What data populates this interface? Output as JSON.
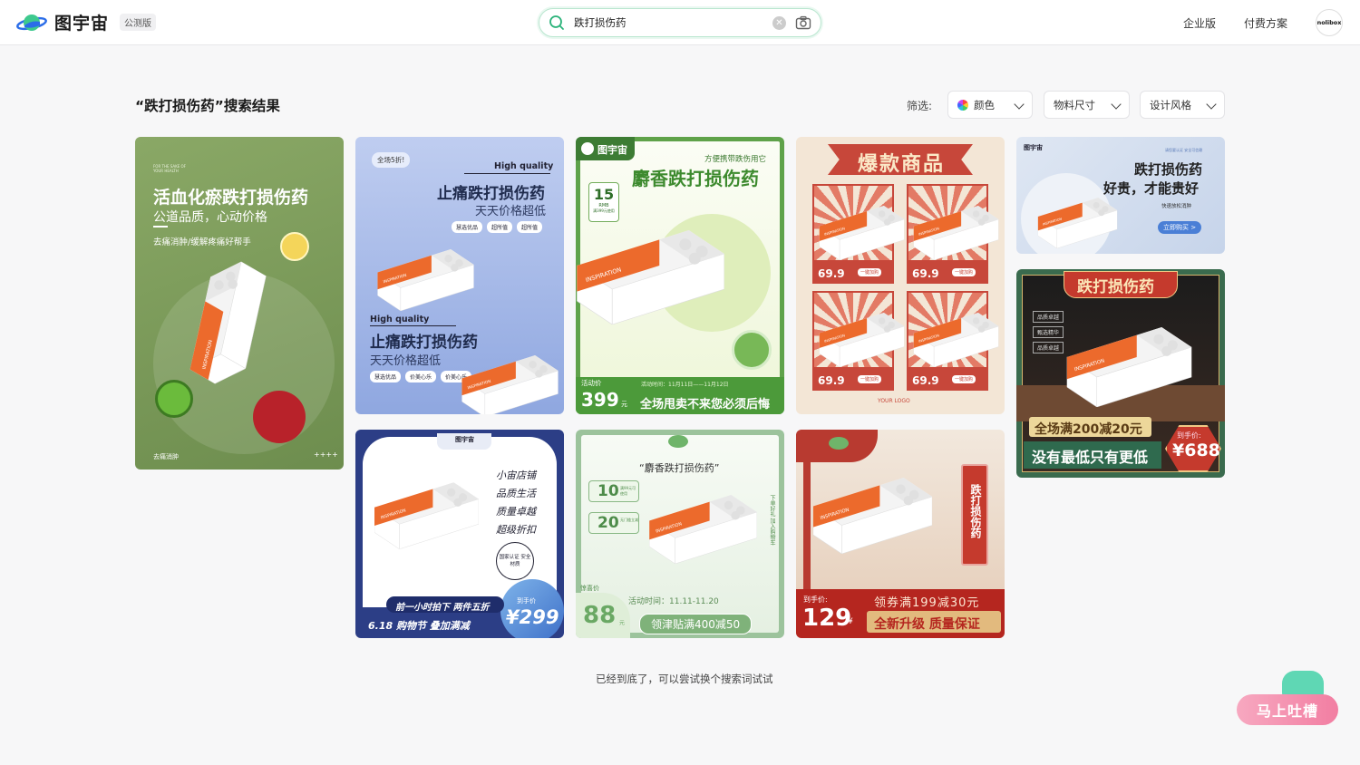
{
  "header": {
    "logo_text": "图宇宙",
    "beta_label": "公测版",
    "search_value": "跌打损伤药",
    "clear_icon": "close-circle-icon",
    "camera_icon": "camera-icon",
    "nav": [
      "企业版",
      "付费方案"
    ],
    "avatar_text": "nolibox"
  },
  "results": {
    "title": "“跌打损伤药”搜索结果",
    "filter_label": "筛选:",
    "filters": [
      "颜色",
      "物料尺寸",
      "设计风格"
    ]
  },
  "cards": {
    "c1": {
      "small": "FOR THE SAKE OF YOUR HEALTH",
      "title": "活血化瘀跌打损伤药",
      "sub": "公道品质，心动价格",
      "desc": "去痛消肿/缓解疼痛好帮手",
      "bottom_left": "去痛消肿",
      "bottom_right": "++++"
    },
    "c2": {
      "badge": "全场5折!",
      "en1": "High quality",
      "t1": "止痛跌打损伤药",
      "s1": "天天价格超低",
      "tags1": [
        "慧选优品",
        "超所值",
        "超所值"
      ],
      "en2": "High quality",
      "t2": "止痛跌打损伤药",
      "s2": "天天价格超低",
      "tags2": [
        "慧选优品",
        "价美心乐",
        "价美心乐"
      ]
    },
    "c3": {
      "logo": "图宇宙",
      "tagline": "方便携带跌伤用它",
      "title": "麝香跌打损伤药",
      "coupon_num": "15",
      "coupon_unit": "RMB",
      "coupon_note": "满399元使用",
      "time_label": "活动价",
      "time_text": "活动时间：11月11日——11月12日",
      "price": "399",
      "price_unit": "元",
      "slogan": "全场甩卖不来您必须后悔"
    },
    "c4": {
      "title": "爆款商品",
      "prices": [
        "69.9",
        "69.9",
        "69.9",
        "69.9"
      ],
      "price_label": "到手价",
      "btn": "一键加购",
      "logo": "YOUR LOGO"
    },
    "c5": {
      "logo": "图宇宙",
      "corner": "请您要认证 安全可信赖",
      "t1": "跌打损伤药",
      "t2": "好贵，才能贵好",
      "sub": "快速放松消肿",
      "btn": "立即购买 >"
    },
    "c6": {
      "title": "跌打损伤药",
      "tags": [
        "品质卓越",
        "甄选精华",
        "品质卓越"
      ],
      "deal": "全场满200减20元",
      "slogan": "没有最低只有更低",
      "price_label": "到手价:",
      "price": "¥688"
    },
    "c7": {
      "logo": "图宇宙",
      "lines": [
        "小宙店铺",
        "品质生活",
        "质量卓越",
        "超级折扣"
      ],
      "seal": "国家认证 安全材质",
      "banner1": "前一小时拍下 两件五折",
      "banner2": "6.18 购物节  叠加满减",
      "price_label": "到手价",
      "price": "¥299"
    },
    "c8": {
      "title": "“麝香跌打损伤药”",
      "c1_num": "10",
      "c1_note": "满99元可使用",
      "c2_num": "20",
      "c2_note": "无门槛立减",
      "side": "下单好礼 加入购物车",
      "label": "惊喜价",
      "price": "88",
      "unit": "元",
      "time": "活动时间：11.11-11.20",
      "deal": "领津贴满400减50"
    },
    "c9": {
      "vertical": "跌打损伤药",
      "price_label": "到手价:",
      "price": "129",
      "unit": "¥",
      "deal1": "领券满199减30元",
      "deal2": "全新升级 质量保证"
    }
  },
  "footer": {
    "note": "已经到底了，可以尝试换个搜索词试试",
    "feedback": "马上吐槽"
  }
}
